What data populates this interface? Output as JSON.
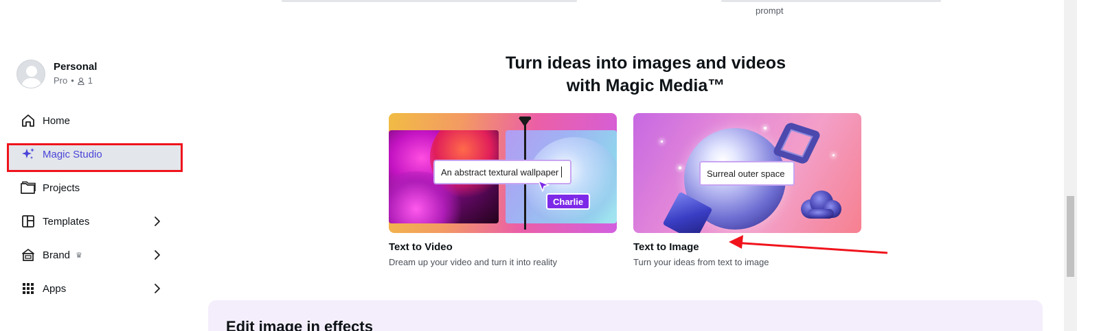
{
  "top_fragment": {
    "text": "prompt"
  },
  "account": {
    "name": "Personal",
    "plan": "Pro",
    "members": "1"
  },
  "nav": {
    "items": [
      {
        "label": "Home",
        "icon": "home-icon"
      },
      {
        "label": "Magic Studio",
        "icon": "sparkle-icon",
        "active": true
      },
      {
        "label": "Projects",
        "icon": "folder-icon"
      },
      {
        "label": "Templates",
        "icon": "templates-icon",
        "chevron": true
      },
      {
        "label": "Brand",
        "icon": "brand-icon",
        "crown": "♛",
        "chevron": true
      },
      {
        "label": "Apps",
        "icon": "apps-grid-icon",
        "chevron": true
      }
    ]
  },
  "main": {
    "headline_line1": "Turn ideas into images and videos",
    "headline_line2": "with Magic Media™",
    "cards": [
      {
        "title": "Text to Video",
        "description": "Dream up your video and turn it into reality",
        "prompt": "An abstract textural wallpaper",
        "user_tag": "Charlie"
      },
      {
        "title": "Text to Image",
        "description": "Turn your ideas from text to image",
        "prompt": "Surreal outer space"
      }
    ],
    "bottom_card_title": "Edit image in effects"
  },
  "colors": {
    "active_nav": "#4a44d9",
    "highlight_border": "#f0131c",
    "user_tag": "#7d2ae8",
    "annotation_arrow": "#f0131c"
  }
}
